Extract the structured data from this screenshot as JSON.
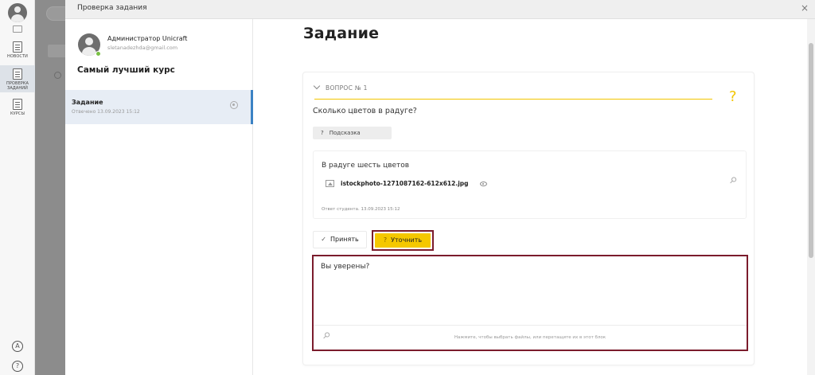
{
  "rail": {
    "items": [
      {
        "label": "НОВОСТИ"
      },
      {
        "label": "ПРОВЕРКА ЗАДАНИЙ"
      },
      {
        "label": "КУРСЫ"
      }
    ],
    "bottom": [
      {
        "icon": "translate-icon",
        "glyph": "A"
      },
      {
        "icon": "help-icon",
        "glyph": "?"
      }
    ]
  },
  "modal": {
    "title": "Проверка задания",
    "close_glyph": "×"
  },
  "side": {
    "user_name": "Администратор Unicraft",
    "user_email": "sletanadezhda@gmail.com",
    "course_title": "Самый лучший курс",
    "task": {
      "title": "Задание",
      "status": "Отвечено 13.09.2023 15:12"
    }
  },
  "content": {
    "page_title": "Задание",
    "question": {
      "header": "ВОПРОС № 1",
      "mark": "?",
      "text": "Сколько цветов в радуге?",
      "hint_label": "Подсказка",
      "hint_glyph": "?"
    },
    "answer": {
      "text": "В радуге шесть цветов",
      "file_name": "istockphoto-1271087162-612x612.jpg",
      "meta": "Ответ студента. 13.09.2023 15:12"
    },
    "actions": {
      "accept_label": "Принять",
      "accept_glyph": "✓",
      "clarify_label": "Уточнить",
      "clarify_glyph": "?"
    },
    "reply": {
      "text": "Вы уверены?",
      "dropzone_text": "Нажмите, чтобы выбрать файлы, или перетащите их в этот блок"
    }
  },
  "colors": {
    "accent_yellow": "#f5c800",
    "highlight_frame": "#7b1c2c",
    "active_blue": "#3b82c4"
  }
}
